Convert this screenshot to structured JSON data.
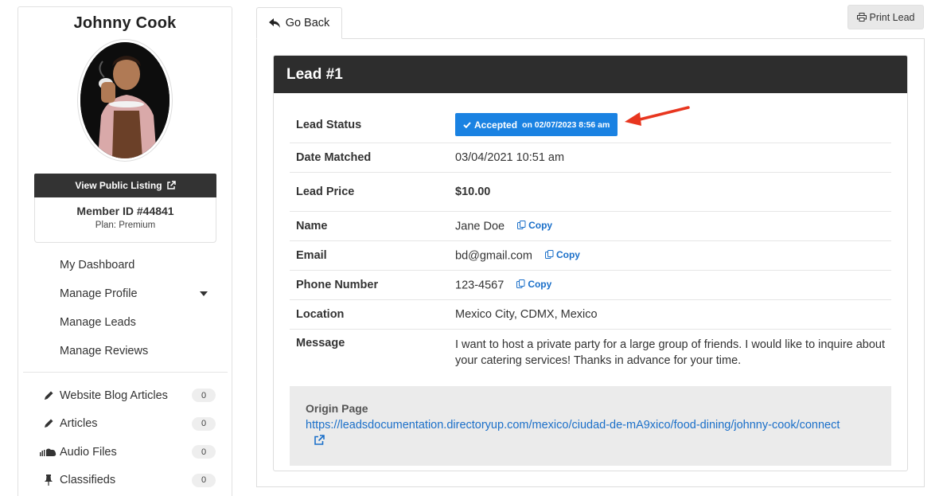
{
  "profile": {
    "name": "Johnny Cook",
    "view_listing_label": "View Public Listing",
    "member_id": "Member ID #44841",
    "plan": "Plan: Premium"
  },
  "nav": {
    "items": [
      {
        "label": "My Dashboard"
      },
      {
        "label": "Manage Profile"
      },
      {
        "label": "Manage Leads"
      },
      {
        "label": "Manage Reviews"
      }
    ],
    "sub_items": [
      {
        "label": "Website Blog Articles",
        "count": "0",
        "icon": "pencil-icon"
      },
      {
        "label": "Articles",
        "count": "0",
        "icon": "pencil-icon"
      },
      {
        "label": "Audio Files",
        "count": "0",
        "icon": "soundcloud-icon"
      },
      {
        "label": "Classifieds",
        "count": "0",
        "icon": "pin-icon"
      }
    ]
  },
  "toolbar": {
    "go_back_label": "Go Back",
    "print_label": "Print Lead"
  },
  "lead": {
    "title": "Lead #1",
    "rows": {
      "status_label": "Lead Status",
      "status_value": "Accepted",
      "status_date": "on 02/07/2023 8:56 am",
      "date_label": "Date Matched",
      "date_value": "03/04/2021 10:51 am",
      "price_label": "Lead Price",
      "price_value": "$10.00",
      "name_label": "Name",
      "name_value": "Jane Doe",
      "email_label": "Email",
      "email_value": "bd@gmail.com",
      "phone_label": "Phone Number",
      "phone_value": "123-4567",
      "location_label": "Location",
      "location_value": "Mexico City, CDMX, Mexico",
      "message_label": "Message",
      "message_value": "I want to host a private party for a large group of friends. I would like to inquire about your catering services! Thanks in advance for your time."
    },
    "copy_label": "Copy",
    "origin_title": "Origin Page",
    "origin_url": "https://leadsdocumentation.directoryup.com/mexico/ciudad-de-mA9xico/food-dining/johnny-cook/connect"
  },
  "colors": {
    "accent": "#1a82e2",
    "link": "#1a6fc9",
    "header_dark": "#2d2d2d",
    "annotation_arrow": "#e8361f"
  }
}
